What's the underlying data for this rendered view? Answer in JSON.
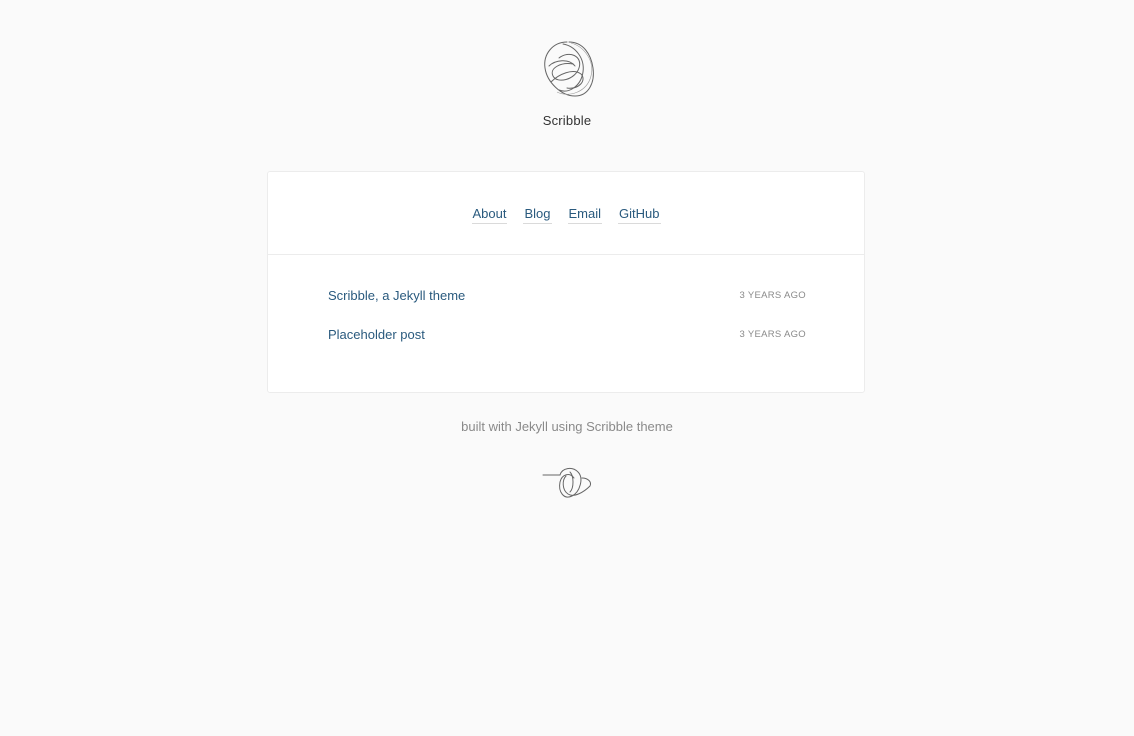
{
  "site": {
    "title": "Scribble"
  },
  "nav": {
    "items": [
      {
        "label": "About"
      },
      {
        "label": "Blog"
      },
      {
        "label": "Email"
      },
      {
        "label": "GitHub"
      }
    ]
  },
  "posts": [
    {
      "title": "Scribble, a Jekyll theme",
      "date": "3 YEARS AGO"
    },
    {
      "title": "Placeholder post",
      "date": "3 YEARS AGO"
    }
  ],
  "footer": {
    "text": "built with Jekyll using Scribble theme"
  },
  "icons": {
    "logo": "scribble-logo-icon",
    "footer": "scribble-footer-icon"
  },
  "colors": {
    "background": "#fafafa",
    "card": "#ffffff",
    "link": "#2a5a7e",
    "muted": "#8a8a8a"
  }
}
